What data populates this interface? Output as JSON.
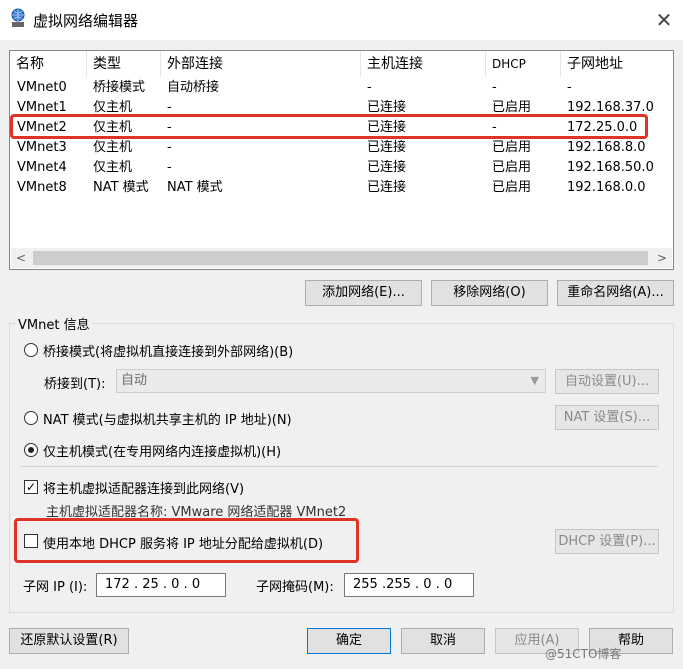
{
  "window": {
    "title": "虚拟网络编辑器",
    "close": "✕"
  },
  "table": {
    "columns": [
      "名称",
      "类型",
      "外部连接",
      "主机连接",
      "DHCP",
      "子网地址"
    ],
    "rows": [
      [
        "VMnet0",
        "桥接模式",
        "自动桥接",
        "-",
        "-",
        "-"
      ],
      [
        "VMnet1",
        "仅主机",
        "-",
        "已连接",
        "已启用",
        "192.168.37.0"
      ],
      [
        "VMnet2",
        "仅主机",
        "-",
        "已连接",
        "-",
        "172.25.0.0"
      ],
      [
        "VMnet3",
        "仅主机",
        "-",
        "已连接",
        "已启用",
        "192.168.8.0"
      ],
      [
        "VMnet4",
        "仅主机",
        "-",
        "已连接",
        "已启用",
        "192.168.50.0"
      ],
      [
        "VMnet8",
        "NAT 模式",
        "NAT 模式",
        "已连接",
        "已启用",
        "192.168.0.0"
      ]
    ],
    "selected_row": 2
  },
  "buttons": {
    "add_network": "添加网络(E)...",
    "remove_network": "移除网络(O)",
    "rename_network": "重命名网络(A)...",
    "auto_settings": "自动设置(U)...",
    "nat_settings": "NAT 设置(S)...",
    "dhcp_settings": "DHCP 设置(P)...",
    "restore_defaults": "还原默认设置(R)",
    "ok": "确定",
    "cancel": "取消",
    "apply": "应用(A)",
    "help": "帮助"
  },
  "vmnet_info": {
    "group_label": "VMnet 信息",
    "bridged_mode": "桥接模式(将虚拟机直接连接到外部网络)(B)",
    "bridged_to_label": "桥接到(T):",
    "bridged_to_value": "自动",
    "nat_mode": "NAT 模式(与虚拟机共享主机的 IP 地址)(N)",
    "host_only_mode": "仅主机模式(在专用网络内连接虚拟机)(H)",
    "selected_mode": "host_only",
    "connect_adapter": "将主机虚拟适配器连接到此网络(V)",
    "connect_adapter_checked": true,
    "adapter_name": "主机虚拟适配器名称: VMware 网络适配器 VMnet2",
    "use_dhcp": "使用本地 DHCP 服务将 IP 地址分配给虚拟机(D)",
    "use_dhcp_checked": false,
    "subnet_ip_label": "子网 IP (I):",
    "subnet_ip": "172 . 25 .  0  .  0",
    "subnet_mask_label": "子网掩码(M):",
    "subnet_mask": "255 .255 .  0  .  0"
  },
  "watermark": "@51CTO博客",
  "colors": {
    "highlight": "#e03327",
    "accent": "#0078d7"
  }
}
